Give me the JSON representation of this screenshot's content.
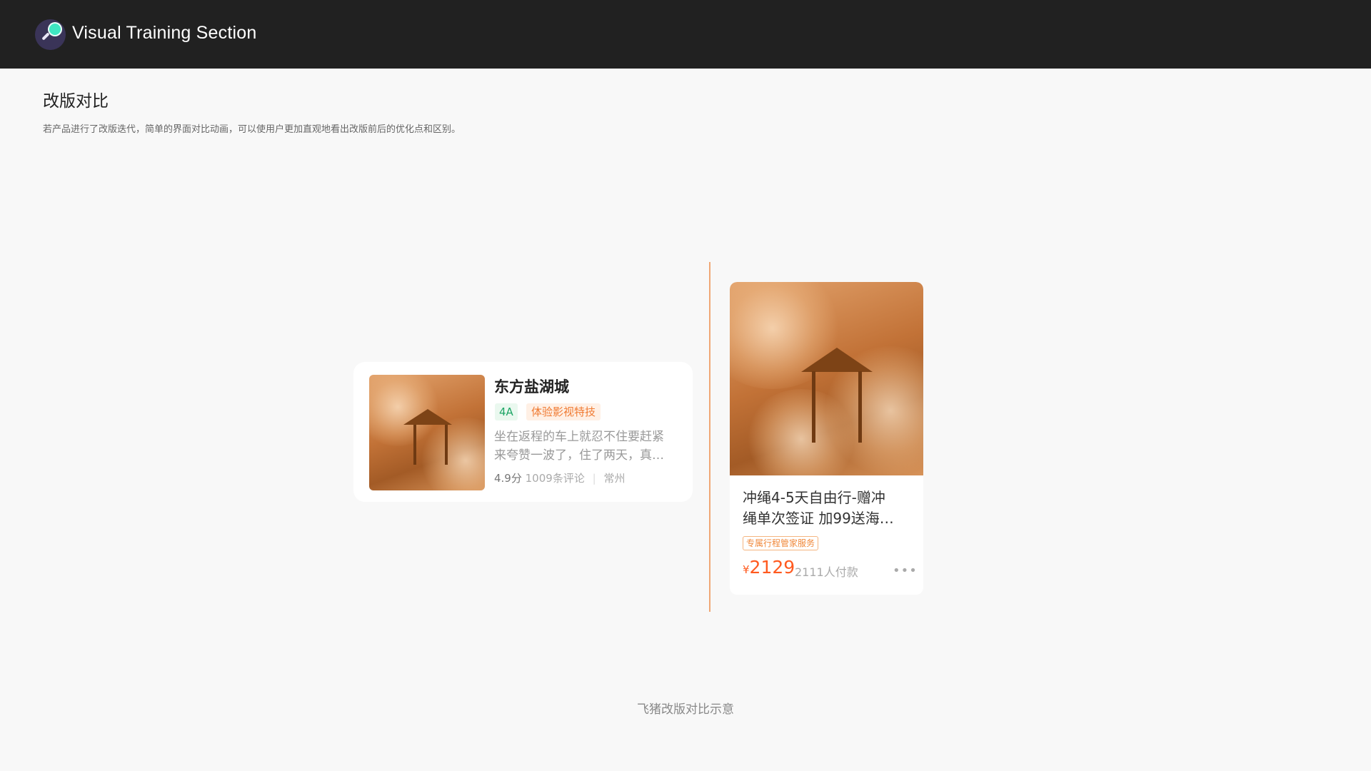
{
  "app": {
    "title": "Visual Training Section"
  },
  "page": {
    "title": "改版对比",
    "description": "若产品进行了改版迭代，简单的界面对比动画，可以使用户更加直观地看出改版前后的优化点和区别。"
  },
  "card_horizontal": {
    "title": "东方盐湖城",
    "badge_level": "4A",
    "badge_tag": "体验影视特技",
    "desc_line1": "坐在返程的车上就忍不住要赶紧",
    "desc_line2": "来夸赞一波了，住了两天，真…",
    "rating": "4.9分",
    "reviews": "1009条评论",
    "separator": "|",
    "city": "常州"
  },
  "card_vertical": {
    "title_line1": "冲绳4-5天自由行-赠冲",
    "title_line2": "绳单次签证 加99送海…",
    "tag": "专属行程管家服务",
    "currency": "¥",
    "price": "2129",
    "paid": "2111人付款",
    "more_label": "•••"
  },
  "caption": "飞猪改版对比示意",
  "colors": {
    "topbar": "#212121",
    "divider": "#f0a876",
    "price": "#ff5a1f",
    "badge_green": "#1da565",
    "badge_orange": "#f07a32"
  },
  "icons": {
    "logo": "magnifier-logo-icon",
    "more": "more-dots-icon"
  }
}
